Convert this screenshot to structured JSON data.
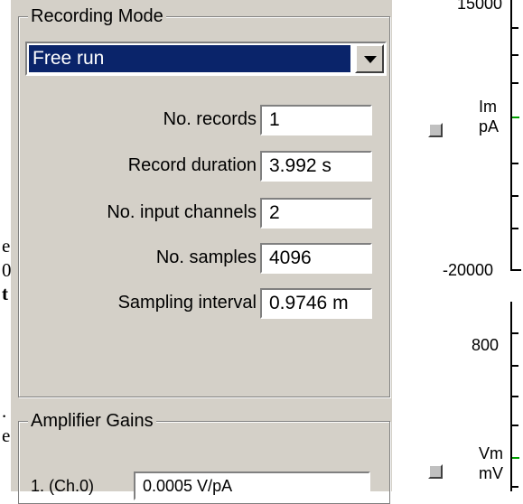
{
  "doc_fragments": [
    {
      "text": "e",
      "bold": false
    },
    {
      "text": "0",
      "bold": false
    },
    {
      "text": "t",
      "bold": true
    },
    {
      "text": ".",
      "bold": false
    },
    {
      "text": "e",
      "bold": false
    }
  ],
  "recording_mode": {
    "title": "Recording Mode",
    "mode_select": {
      "value": "Free run"
    },
    "fields": [
      {
        "label": "No. records",
        "value": "1"
      },
      {
        "label": "Record duration",
        "value": "3.992 s"
      },
      {
        "label": "No. input channels",
        "value": "2"
      },
      {
        "label": "No. samples",
        "value": "4096"
      },
      {
        "label": "Sampling interval",
        "value": "0.9746 m"
      }
    ]
  },
  "amplifier_gains": {
    "title": "Amplifier Gains",
    "channels": [
      {
        "label": "1. (Ch.0)",
        "value": "0.0005 V/pA"
      }
    ]
  },
  "channel_displays": [
    {
      "name": "Im",
      "unit": "pA",
      "top_value": "15000",
      "bottom_value": "-20000"
    },
    {
      "name": "Vm",
      "unit": "mV",
      "top_value": "800"
    }
  ]
}
